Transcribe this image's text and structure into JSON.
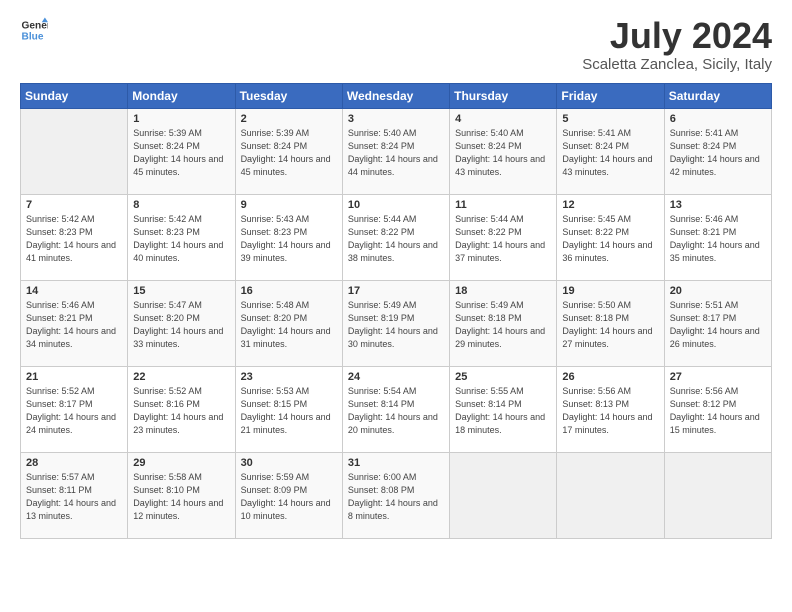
{
  "logo": {
    "line1": "General",
    "line2": "Blue",
    "icon_color": "#4a90d9"
  },
  "header": {
    "month": "July 2024",
    "location": "Scaletta Zanclea, Sicily, Italy"
  },
  "weekdays": [
    "Sunday",
    "Monday",
    "Tuesday",
    "Wednesday",
    "Thursday",
    "Friday",
    "Saturday"
  ],
  "weeks": [
    [
      {
        "day": "",
        "sunrise": "",
        "sunset": "",
        "daylight": ""
      },
      {
        "day": "1",
        "sunrise": "Sunrise: 5:39 AM",
        "sunset": "Sunset: 8:24 PM",
        "daylight": "Daylight: 14 hours and 45 minutes."
      },
      {
        "day": "2",
        "sunrise": "Sunrise: 5:39 AM",
        "sunset": "Sunset: 8:24 PM",
        "daylight": "Daylight: 14 hours and 45 minutes."
      },
      {
        "day": "3",
        "sunrise": "Sunrise: 5:40 AM",
        "sunset": "Sunset: 8:24 PM",
        "daylight": "Daylight: 14 hours and 44 minutes."
      },
      {
        "day": "4",
        "sunrise": "Sunrise: 5:40 AM",
        "sunset": "Sunset: 8:24 PM",
        "daylight": "Daylight: 14 hours and 43 minutes."
      },
      {
        "day": "5",
        "sunrise": "Sunrise: 5:41 AM",
        "sunset": "Sunset: 8:24 PM",
        "daylight": "Daylight: 14 hours and 43 minutes."
      },
      {
        "day": "6",
        "sunrise": "Sunrise: 5:41 AM",
        "sunset": "Sunset: 8:24 PM",
        "daylight": "Daylight: 14 hours and 42 minutes."
      }
    ],
    [
      {
        "day": "7",
        "sunrise": "Sunrise: 5:42 AM",
        "sunset": "Sunset: 8:23 PM",
        "daylight": "Daylight: 14 hours and 41 minutes."
      },
      {
        "day": "8",
        "sunrise": "Sunrise: 5:42 AM",
        "sunset": "Sunset: 8:23 PM",
        "daylight": "Daylight: 14 hours and 40 minutes."
      },
      {
        "day": "9",
        "sunrise": "Sunrise: 5:43 AM",
        "sunset": "Sunset: 8:23 PM",
        "daylight": "Daylight: 14 hours and 39 minutes."
      },
      {
        "day": "10",
        "sunrise": "Sunrise: 5:44 AM",
        "sunset": "Sunset: 8:22 PM",
        "daylight": "Daylight: 14 hours and 38 minutes."
      },
      {
        "day": "11",
        "sunrise": "Sunrise: 5:44 AM",
        "sunset": "Sunset: 8:22 PM",
        "daylight": "Daylight: 14 hours and 37 minutes."
      },
      {
        "day": "12",
        "sunrise": "Sunrise: 5:45 AM",
        "sunset": "Sunset: 8:22 PM",
        "daylight": "Daylight: 14 hours and 36 minutes."
      },
      {
        "day": "13",
        "sunrise": "Sunrise: 5:46 AM",
        "sunset": "Sunset: 8:21 PM",
        "daylight": "Daylight: 14 hours and 35 minutes."
      }
    ],
    [
      {
        "day": "14",
        "sunrise": "Sunrise: 5:46 AM",
        "sunset": "Sunset: 8:21 PM",
        "daylight": "Daylight: 14 hours and 34 minutes."
      },
      {
        "day": "15",
        "sunrise": "Sunrise: 5:47 AM",
        "sunset": "Sunset: 8:20 PM",
        "daylight": "Daylight: 14 hours and 33 minutes."
      },
      {
        "day": "16",
        "sunrise": "Sunrise: 5:48 AM",
        "sunset": "Sunset: 8:20 PM",
        "daylight": "Daylight: 14 hours and 31 minutes."
      },
      {
        "day": "17",
        "sunrise": "Sunrise: 5:49 AM",
        "sunset": "Sunset: 8:19 PM",
        "daylight": "Daylight: 14 hours and 30 minutes."
      },
      {
        "day": "18",
        "sunrise": "Sunrise: 5:49 AM",
        "sunset": "Sunset: 8:18 PM",
        "daylight": "Daylight: 14 hours and 29 minutes."
      },
      {
        "day": "19",
        "sunrise": "Sunrise: 5:50 AM",
        "sunset": "Sunset: 8:18 PM",
        "daylight": "Daylight: 14 hours and 27 minutes."
      },
      {
        "day": "20",
        "sunrise": "Sunrise: 5:51 AM",
        "sunset": "Sunset: 8:17 PM",
        "daylight": "Daylight: 14 hours and 26 minutes."
      }
    ],
    [
      {
        "day": "21",
        "sunrise": "Sunrise: 5:52 AM",
        "sunset": "Sunset: 8:17 PM",
        "daylight": "Daylight: 14 hours and 24 minutes."
      },
      {
        "day": "22",
        "sunrise": "Sunrise: 5:52 AM",
        "sunset": "Sunset: 8:16 PM",
        "daylight": "Daylight: 14 hours and 23 minutes."
      },
      {
        "day": "23",
        "sunrise": "Sunrise: 5:53 AM",
        "sunset": "Sunset: 8:15 PM",
        "daylight": "Daylight: 14 hours and 21 minutes."
      },
      {
        "day": "24",
        "sunrise": "Sunrise: 5:54 AM",
        "sunset": "Sunset: 8:14 PM",
        "daylight": "Daylight: 14 hours and 20 minutes."
      },
      {
        "day": "25",
        "sunrise": "Sunrise: 5:55 AM",
        "sunset": "Sunset: 8:14 PM",
        "daylight": "Daylight: 14 hours and 18 minutes."
      },
      {
        "day": "26",
        "sunrise": "Sunrise: 5:56 AM",
        "sunset": "Sunset: 8:13 PM",
        "daylight": "Daylight: 14 hours and 17 minutes."
      },
      {
        "day": "27",
        "sunrise": "Sunrise: 5:56 AM",
        "sunset": "Sunset: 8:12 PM",
        "daylight": "Daylight: 14 hours and 15 minutes."
      }
    ],
    [
      {
        "day": "28",
        "sunrise": "Sunrise: 5:57 AM",
        "sunset": "Sunset: 8:11 PM",
        "daylight": "Daylight: 14 hours and 13 minutes."
      },
      {
        "day": "29",
        "sunrise": "Sunrise: 5:58 AM",
        "sunset": "Sunset: 8:10 PM",
        "daylight": "Daylight: 14 hours and 12 minutes."
      },
      {
        "day": "30",
        "sunrise": "Sunrise: 5:59 AM",
        "sunset": "Sunset: 8:09 PM",
        "daylight": "Daylight: 14 hours and 10 minutes."
      },
      {
        "day": "31",
        "sunrise": "Sunrise: 6:00 AM",
        "sunset": "Sunset: 8:08 PM",
        "daylight": "Daylight: 14 hours and 8 minutes."
      },
      {
        "day": "",
        "sunrise": "",
        "sunset": "",
        "daylight": ""
      },
      {
        "day": "",
        "sunrise": "",
        "sunset": "",
        "daylight": ""
      },
      {
        "day": "",
        "sunrise": "",
        "sunset": "",
        "daylight": ""
      }
    ]
  ]
}
